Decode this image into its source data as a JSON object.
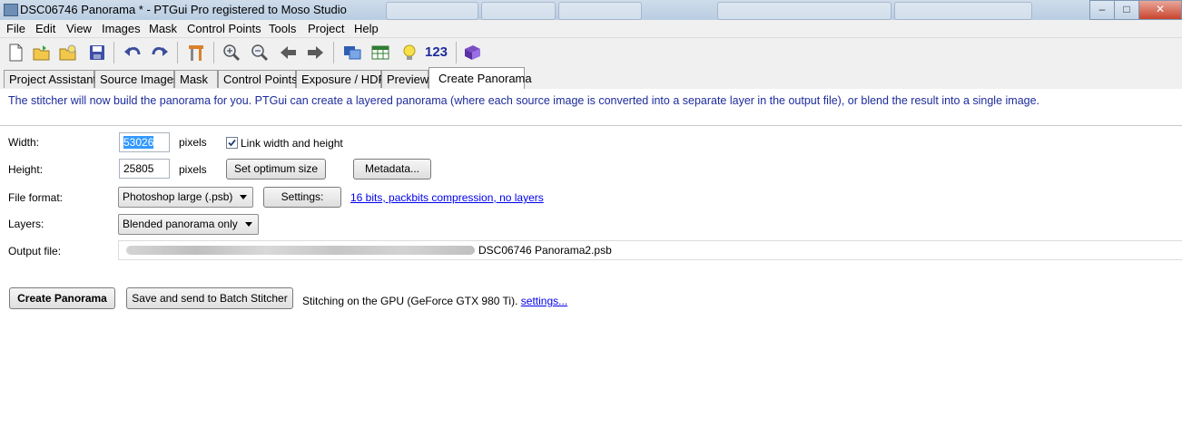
{
  "window": {
    "title": "DSC06746 Panorama * - PTGui Pro registered to Moso Studio",
    "controls": {
      "minimize": "–",
      "maximize": "□",
      "close": "✕"
    }
  },
  "menubar": [
    "File",
    "Edit",
    "View",
    "Images",
    "Mask",
    "Control Points",
    "Tools",
    "Project",
    "Help"
  ],
  "toolbar": {
    "icons": [
      "new-icon",
      "open-icon",
      "open-recent-icon",
      "save-icon",
      "undo-icon",
      "redo-icon",
      "tools-icon",
      "zoom-in-icon",
      "zoom-out-icon",
      "back-icon",
      "forward-icon",
      "panorama-editor-icon",
      "table-icon",
      "lightbulb-icon",
      "numbers-icon",
      "help-book-icon"
    ],
    "numbers_label": "123"
  },
  "tabs": [
    "Project Assistant",
    "Source Images",
    "Mask",
    "Control Points",
    "Exposure / HDR",
    "Preview",
    "Create Panorama"
  ],
  "active_tab": "Create Panorama",
  "intro": "The stitcher will now build the panorama for you. PTGui can create a layered panorama (where each source image is converted into a separate layer in the output file), or blend the result into a single image.",
  "form": {
    "width_label": "Width:",
    "width_value": "53026",
    "height_label": "Height:",
    "height_value": "25805",
    "pixels_unit": "pixels",
    "link_label": "Link width and height",
    "link_checked": true,
    "set_optimum_label": "Set optimum size",
    "metadata_label": "Metadata...",
    "file_format_label": "File format:",
    "file_format_value": "Photoshop large (.psb)",
    "settings_label": "Settings:",
    "format_link": "16 bits, packbits compression, no layers",
    "layers_label": "Layers:",
    "layers_value": "Blended panorama only",
    "output_label": "Output file:",
    "output_filename": "DSC06746 Panorama2.psb"
  },
  "actions": {
    "create_label": "Create Panorama",
    "batch_label": "Save and send to Batch Stitcher",
    "gpu_text": "Stitching on the GPU (GeForce GTX 980 Ti).",
    "gpu_settings_link": "settings..."
  },
  "colors": {
    "intro_text": "#1d2b9b",
    "link": "#0000ee",
    "selection": "#3399ff"
  }
}
